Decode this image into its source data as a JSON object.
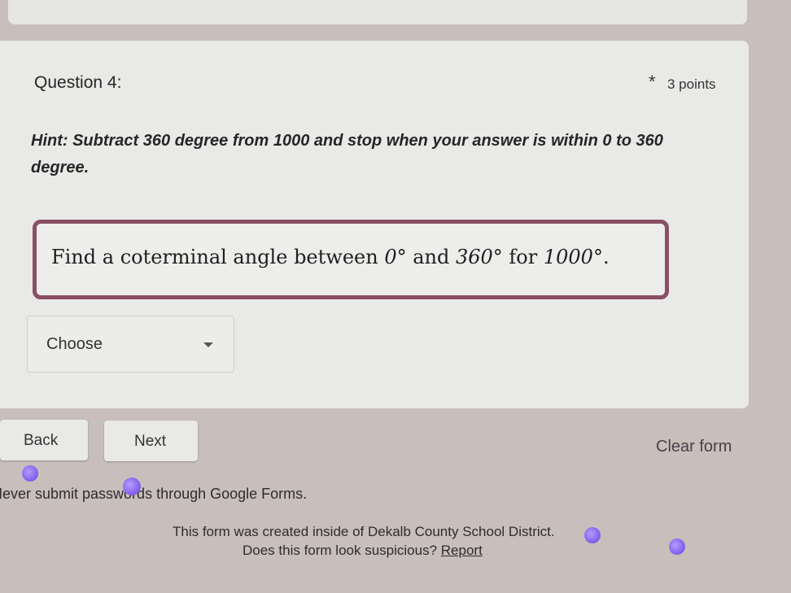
{
  "question": {
    "title": "Question 4:",
    "required_marker": "*",
    "points": "3 points",
    "hint": "Hint: Subtract 360 degree from 1000 and stop when your answer is within 0 to 360 degree.",
    "problem": {
      "text_1": "Find a coterminal angle between ",
      "value_1": "0°",
      "text_2": " and ",
      "value_2": "360°",
      "text_3": " for ",
      "value_3": "1000°",
      "text_4": "."
    },
    "dropdown": {
      "label": "Choose"
    }
  },
  "navigation": {
    "back_label": "Back",
    "next_label": "Next",
    "clear_label": "Clear form"
  },
  "footer": {
    "warning": "Never submit passwords through Google Forms.",
    "org_note": "This form was created inside of Dekalb County School District.",
    "suspicious_prefix": "Does this form look suspicious? ",
    "report_label": "Report"
  },
  "colors": {
    "accent_border": "#8a4f63",
    "card_bg": "#e9e9e7",
    "page_bg": "#c8bfbc"
  }
}
